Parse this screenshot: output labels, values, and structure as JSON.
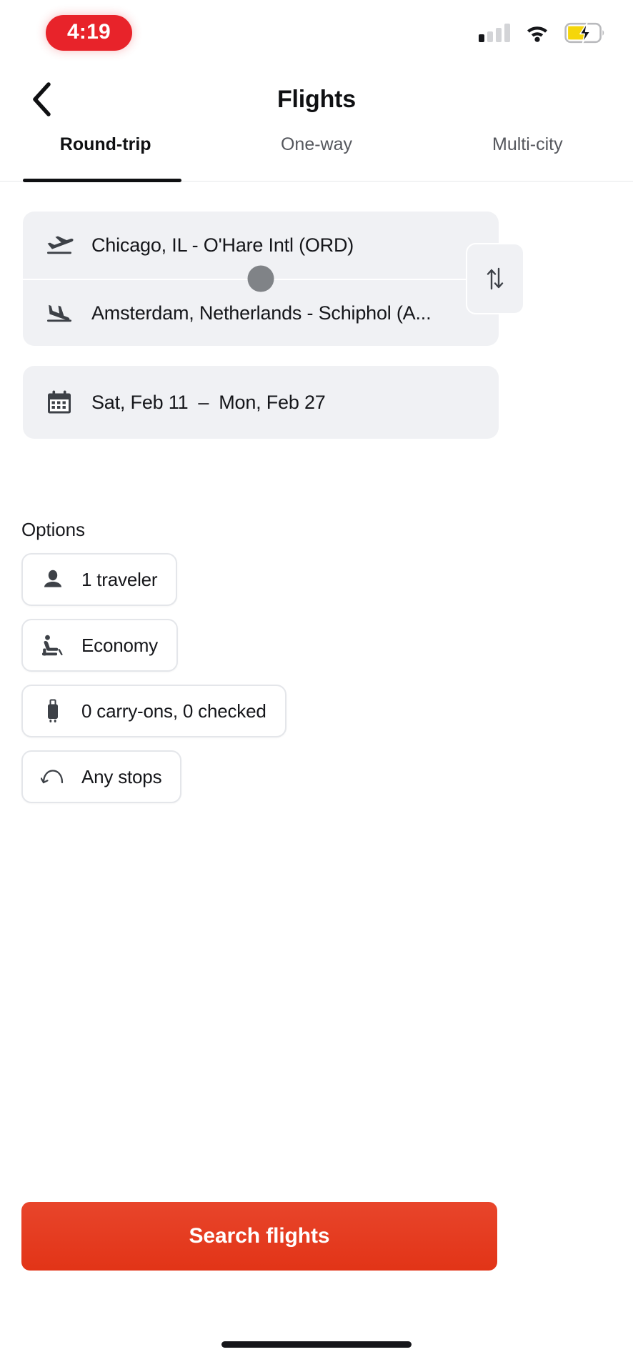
{
  "status_bar": {
    "time": "4:19",
    "time_pill_color": "#e8232a",
    "signal_icon": "cellular-signal-icon",
    "signal_bars_total": 4,
    "signal_bars_filled": 1,
    "wifi_icon": "wifi-icon",
    "battery_icon": "battery-charging-icon",
    "battery_fill_color": "#f5d60a"
  },
  "header": {
    "back_icon": "chevron-left-icon",
    "title": "Flights"
  },
  "tabs": {
    "items": [
      {
        "label": "Round-trip",
        "active": true
      },
      {
        "label": "One-way",
        "active": false
      },
      {
        "label": "Multi-city",
        "active": false
      }
    ]
  },
  "route": {
    "origin": {
      "icon": "flight-takeoff-icon",
      "value": "Chicago, IL - O'Hare Intl (ORD)"
    },
    "destination": {
      "icon": "flight-land-icon",
      "value": "Amsterdam, Netherlands - Schiphol (A..."
    },
    "swap_icon": "swap-vertical-icon"
  },
  "dates": {
    "icon": "calendar-icon",
    "depart": "Sat, Feb 11",
    "separator": "–",
    "return": "Mon, Feb 27"
  },
  "options": {
    "title": "Options",
    "chips": [
      {
        "icon": "person-icon",
        "label": "1 traveler"
      },
      {
        "icon": "airline-seat-icon",
        "label": "Economy"
      },
      {
        "icon": "luggage-icon",
        "label": "0 carry-ons, 0 checked"
      },
      {
        "icon": "stops-arrow-icon",
        "label": "Any stops"
      }
    ]
  },
  "footer": {
    "search_label": "Search flights",
    "search_color": "#e2361a"
  }
}
